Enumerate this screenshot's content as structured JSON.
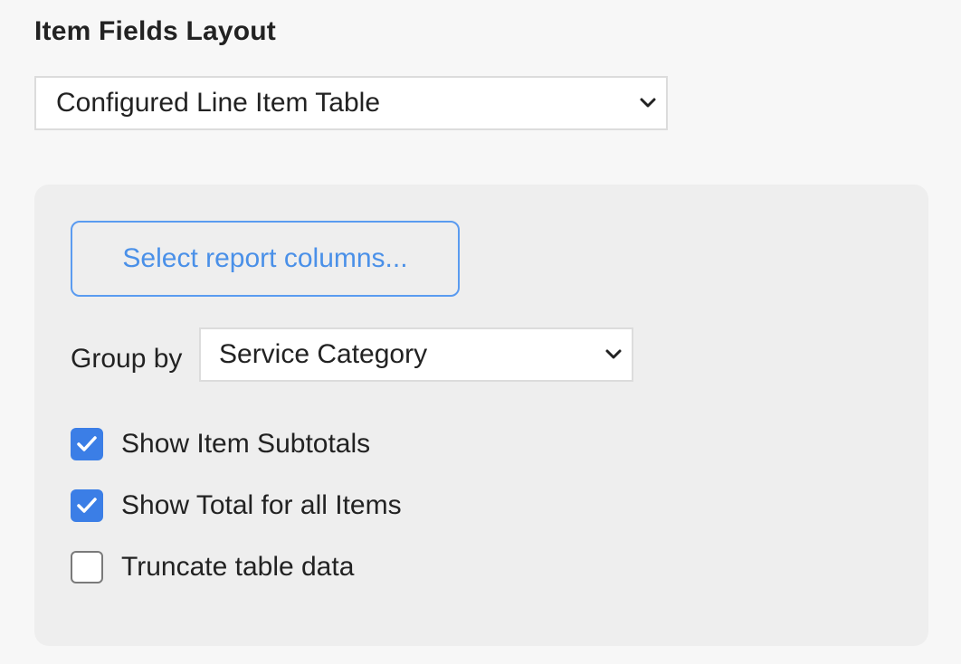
{
  "section": {
    "title": "Item Fields Layout"
  },
  "layout_select": {
    "value": "Configured Line Item Table",
    "icon": "chevron-down-icon"
  },
  "panel": {
    "columns_button_label": "Select report columns...",
    "group_by": {
      "label": "Group by",
      "value": "Service Category",
      "icon": "chevron-down-icon"
    },
    "checkboxes": [
      {
        "label": "Show Item Subtotals",
        "checked": true
      },
      {
        "label": "Show Total for all Items",
        "checked": true
      },
      {
        "label": "Truncate table data",
        "checked": false
      }
    ]
  },
  "colors": {
    "accent": "#3b7ee6",
    "button_text": "#4a90e8",
    "panel_bg": "#eeeeee",
    "page_bg": "#f7f7f7"
  }
}
